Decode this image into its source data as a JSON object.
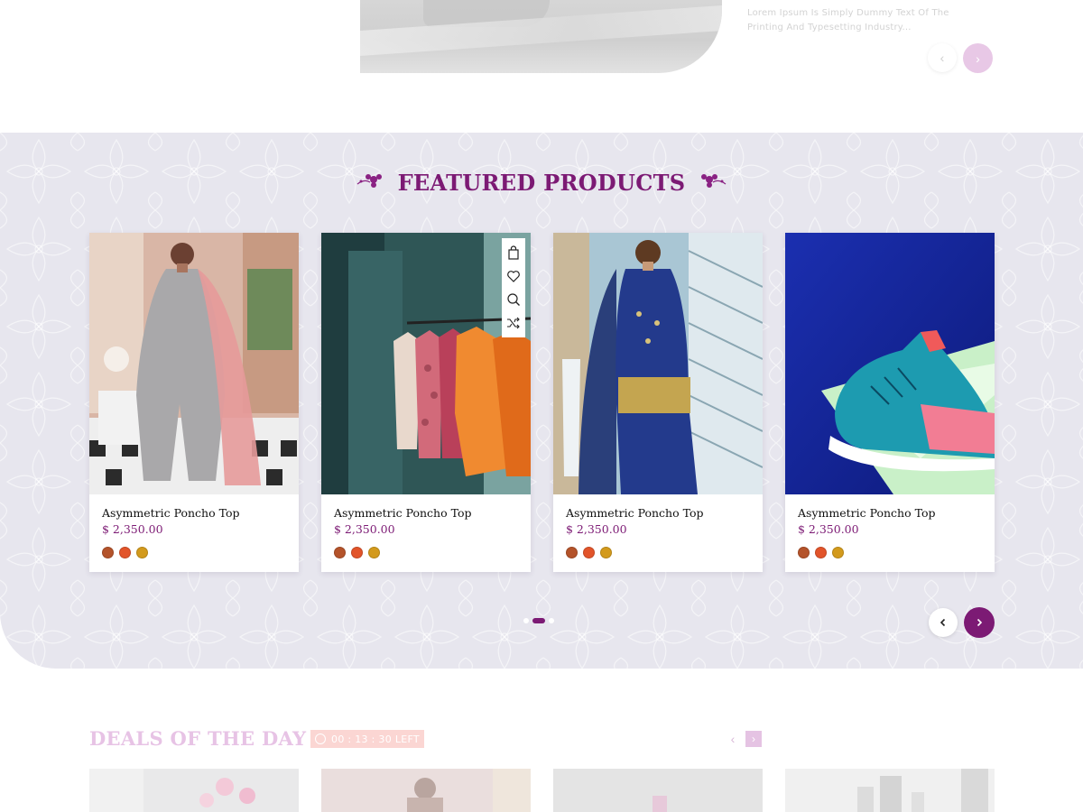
{
  "top_banner": {
    "text": "Lorem Ipsum Is Simply Dummy Text Of The Printing And Typesetting Industry...",
    "prev_icon": "chevron-left-icon",
    "next_icon": "chevron-right-icon"
  },
  "featured": {
    "title": "FEATURED PRODUCTS",
    "ornament_icon": "orchid-flower-icon",
    "products": [
      {
        "name": "Asymmetric Poncho Top",
        "price": "$ 2,350.00",
        "image": "woman-in-embroidered-grey-suit",
        "swatches": [
          "#b4532a",
          "#e2542a",
          "#d39a1c"
        ]
      },
      {
        "name": "Asymmetric Poncho Top",
        "price": "$ 2,350.00",
        "image": "clothes-rack-orange-floral",
        "swatches": [
          "#b4532a",
          "#e2542a",
          "#d39a1c"
        ],
        "actions": [
          "bag-icon",
          "heart-icon",
          "search-icon",
          "shuffle-icon"
        ]
      },
      {
        "name": "Asymmetric Poncho Top",
        "price": "$ 2,350.00",
        "image": "woman-in-blue-embroidered-dress",
        "swatches": [
          "#b4532a",
          "#e2542a",
          "#d39a1c"
        ]
      },
      {
        "name": "Asymmetric Poncho Top",
        "price": "$ 2,350.00",
        "image": "blue-pink-sneaker",
        "swatches": [
          "#b4532a",
          "#e2542a",
          "#d39a1c"
        ]
      }
    ],
    "pagination": {
      "count": 3,
      "active": 2
    },
    "accent_color": "#7c1a74"
  },
  "deals": {
    "title": "DEALS OF THE DAY",
    "timer": "00 : 13 : 30 LEFT"
  }
}
